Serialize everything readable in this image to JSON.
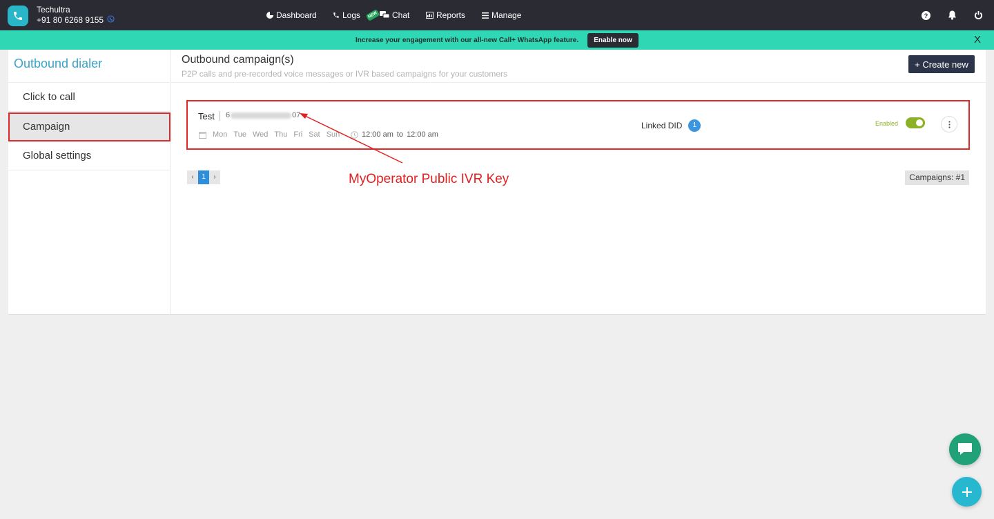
{
  "account": {
    "name": "Techultra",
    "phone": "+91 80 6268 9155"
  },
  "nav": {
    "dashboard": "Dashboard",
    "logs": "Logs",
    "new_badge": "NEW",
    "chat": "Chat",
    "reports": "Reports",
    "manage": "Manage"
  },
  "banner": {
    "text": "Increase your engagement with our all-new Call+ WhatsApp feature.",
    "button": "Enable now",
    "close": "X"
  },
  "sidebar": {
    "title": "Outbound dialer",
    "items": [
      {
        "label": "Click to call"
      },
      {
        "label": "Campaign"
      },
      {
        "label": "Global settings"
      }
    ]
  },
  "content": {
    "title": "Outbound campaign(s)",
    "subtitle": "P2P calls and pre-recorded voice messages or IVR based campaigns for your customers",
    "create_button": "+ Create new"
  },
  "campaign": {
    "name": "Test",
    "key_prefix": "6",
    "key_suffix": "07",
    "days": [
      "Mon",
      "Tue",
      "Wed",
      "Thu",
      "Fri",
      "Sat",
      "Sun"
    ],
    "time_from": "12:00 am",
    "time_sep": "to",
    "time_to": "12:00 am",
    "linked_label": "Linked DID",
    "linked_count": "1",
    "status": "Enabled"
  },
  "pagination": {
    "prev": "‹",
    "current": "1",
    "next": "›"
  },
  "campaign_count": "Campaigns: #1",
  "annotation": "MyOperator Public IVR Key",
  "colors": {
    "topbar": "#2b2b33",
    "banner": "#2fd7b4",
    "accent": "#3aa3c6",
    "highlight": "#e02828",
    "toggle_on": "#8bb126"
  }
}
